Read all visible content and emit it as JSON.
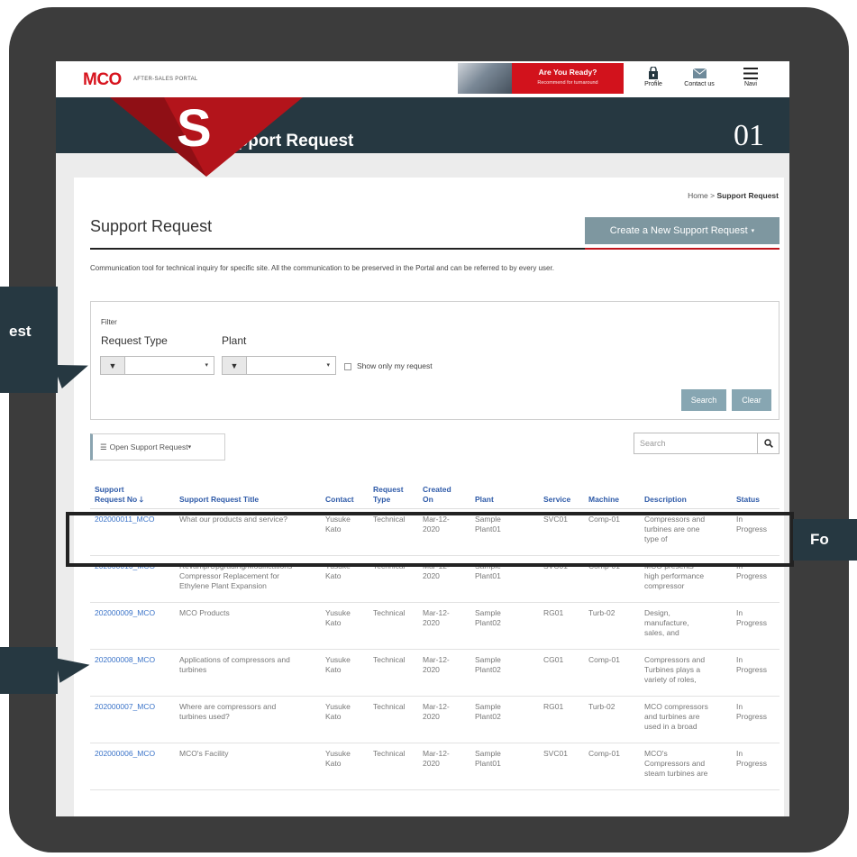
{
  "header": {
    "logo_main": "MCO",
    "logo_sub": "AFTER-SALES PORTAL",
    "promo_title": "Are You Ready?",
    "promo_sub": "Recommend for turnaround",
    "icons": [
      {
        "label": "Profile",
        "icon": "profile-icon"
      },
      {
        "label": "Contact us",
        "icon": "mail-icon"
      },
      {
        "label": "Navi",
        "icon": "hamburger-icon"
      }
    ]
  },
  "banner": {
    "letter": "S",
    "title": "upport Request",
    "number": "01"
  },
  "breadcrumb": {
    "home": "Home",
    "sep": ">",
    "current": "Support Request"
  },
  "page": {
    "title": "Support Request",
    "create_button": "Create a New Support Request",
    "description": "Communication tool for technical inquiry for specific site. All the communication to be preserved in the Portal and can be referred to by every user."
  },
  "filter": {
    "label": "Filter",
    "request_type_label": "Request Type",
    "plant_label": "Plant",
    "show_only_mine": "Show only my request",
    "search_button": "Search",
    "clear_button": "Clear"
  },
  "toolbar": {
    "open_dropdown": "Open Support Request",
    "search_placeholder": "Search"
  },
  "table": {
    "headers": {
      "no_1": "Support",
      "no_2": "Request No",
      "title": "Support Request Title",
      "contact": "Contact",
      "type_1": "Request",
      "type_2": "Type",
      "created_1": "Created",
      "created_2": "On",
      "plant": "Plant",
      "service": "Service",
      "machine": "Machine",
      "description": "Description",
      "status": "Status"
    },
    "rows": [
      {
        "no": "202000011_MCO",
        "title_1": "What our products and service?",
        "title_2": "",
        "title_3": "",
        "contact_1": "Yusuke",
        "contact_2": "Kato",
        "type": "Technical",
        "created_1": "Mar-12-",
        "created_2": "2020",
        "plant_1": "Sample",
        "plant_2": "Plant01",
        "service": "SVC01",
        "machine": "Comp-01",
        "desc_1": "Compressors and",
        "desc_2": "turbines are one",
        "desc_3": "type of",
        "status_1": "In",
        "status_2": "Progress"
      },
      {
        "no": "202000010_MCO",
        "title_1": "Revamp/Upgrading/Modifications",
        "title_2": "Compressor Replacement for",
        "title_3": "Ethylene Plant Expansion",
        "contact_1": "Yusuke",
        "contact_2": "Kato",
        "type": "Technical",
        "created_1": "Mar-12-",
        "created_2": "2020",
        "plant_1": "Sample",
        "plant_2": "Plant01",
        "service": "SVC01",
        "machine": "Comp-01",
        "desc_1": "MCO presents",
        "desc_2": "high performance",
        "desc_3": "compressor",
        "status_1": "In",
        "status_2": "Progress"
      },
      {
        "no": "202000009_MCO",
        "title_1": "MCO Products",
        "title_2": "",
        "title_3": "",
        "contact_1": "Yusuke",
        "contact_2": "Kato",
        "type": "Technical",
        "created_1": "Mar-12-",
        "created_2": "2020",
        "plant_1": "Sample",
        "plant_2": "Plant02",
        "service": "RG01",
        "machine": "Turb-02",
        "desc_1": "Design,",
        "desc_2": "manufacture,",
        "desc_3": "sales, and",
        "status_1": "In",
        "status_2": "Progress"
      },
      {
        "no": "202000008_MCO",
        "title_1": "Applications of compressors and",
        "title_2": "turbines",
        "title_3": "",
        "contact_1": "Yusuke",
        "contact_2": "Kato",
        "type": "Technical",
        "created_1": "Mar-12-",
        "created_2": "2020",
        "plant_1": "Sample",
        "plant_2": "Plant02",
        "service": "CG01",
        "machine": "Comp-01",
        "desc_1": "Compressors and",
        "desc_2": "Turbines plays a",
        "desc_3": "variety of roles,",
        "status_1": "In",
        "status_2": "Progress"
      },
      {
        "no": "202000007_MCO",
        "title_1": "Where are compressors and",
        "title_2": "turbines used?",
        "title_3": "",
        "contact_1": "Yusuke",
        "contact_2": "Kato",
        "type": "Technical",
        "created_1": "Mar-12-",
        "created_2": "2020",
        "plant_1": "Sample",
        "plant_2": "Plant02",
        "service": "RG01",
        "machine": "Turb-02",
        "desc_1": "MCO compressors",
        "desc_2": "and turbines are",
        "desc_3": "used in a broad",
        "status_1": "In",
        "status_2": "Progress"
      },
      {
        "no": "202000006_MCO",
        "title_1": "MCO's Facility",
        "title_2": "",
        "title_3": "",
        "contact_1": "Yusuke",
        "contact_2": "Kato",
        "type": "Technical",
        "created_1": "Mar-12-",
        "created_2": "2020",
        "plant_1": "Sample",
        "plant_2": "Plant01",
        "service": "SVC01",
        "machine": "Comp-01",
        "desc_1": "MCO's",
        "desc_2": "Compressors and",
        "desc_3": "steam turbines are",
        "status_1": "In",
        "status_2": "Progress"
      }
    ]
  },
  "callouts": {
    "left_top": "est",
    "right": "Fo"
  },
  "colors": {
    "brand_red": "#d2121c",
    "banner_dark": "#263841",
    "button_blue_gray": "#7e97a0",
    "link_blue": "#3a73c8"
  }
}
